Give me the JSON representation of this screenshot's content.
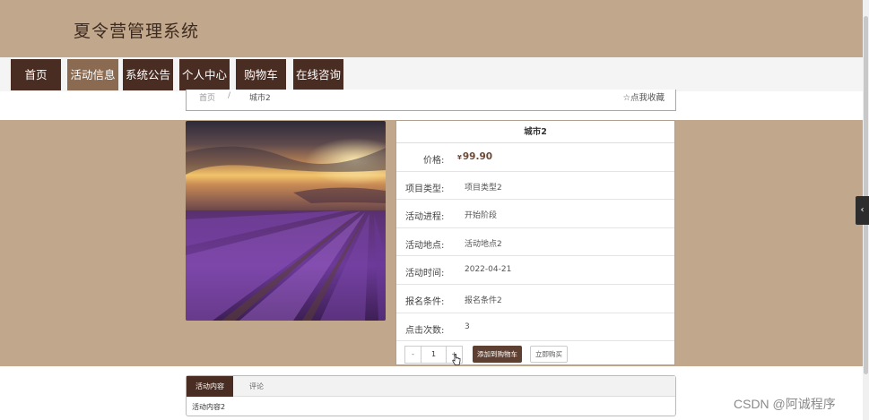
{
  "header": {
    "title": "夏令营管理系统"
  },
  "nav": {
    "items": [
      {
        "label": "首页",
        "active": false
      },
      {
        "label": "活动信息",
        "active": true
      },
      {
        "label": "系统公告",
        "active": false
      },
      {
        "label": "个人中心",
        "active": false
      },
      {
        "label": "购物车",
        "active": false
      },
      {
        "label": "在线咨询",
        "active": false
      }
    ]
  },
  "breadcrumb": {
    "home": "首页",
    "separator": "/",
    "current": "城市2"
  },
  "favorite": {
    "label": "☆点我收藏"
  },
  "product": {
    "image_icon": "lavender-field-sunset-photo",
    "name": "城市2",
    "price": {
      "label": "价格:",
      "currency": "¥",
      "value": "99.90"
    },
    "fields": [
      {
        "label": "项目类型:",
        "value": "项目类型2"
      },
      {
        "label": "活动进程:",
        "value": "开始阶段"
      },
      {
        "label": "活动地点:",
        "value": "活动地点2"
      },
      {
        "label": "活动时间:",
        "value": "2022-04-21"
      },
      {
        "label": "报名条件:",
        "value": "报名条件2"
      },
      {
        "label": "点击次数:",
        "value": "3"
      }
    ]
  },
  "actions": {
    "minus": "-",
    "quantity": "1",
    "plus": "+",
    "add_to_cart": "添加到购物车",
    "buy_now": "立即购买"
  },
  "tabs": {
    "items": [
      {
        "label": "活动内容",
        "active": true
      },
      {
        "label": "评论",
        "active": false
      }
    ],
    "content": "活动内容2"
  },
  "side_toggle": {
    "icon": "chevron-left-icon",
    "glyph": "‹"
  },
  "watermark": "CSDN @阿诚程序",
  "colors": {
    "header_bg": "#c1a78c",
    "nav_dark": "#4a2d22",
    "nav_active": "#8a6b52"
  }
}
